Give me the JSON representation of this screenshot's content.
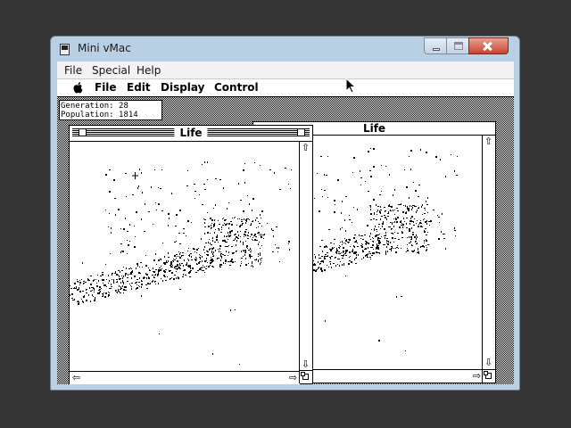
{
  "host": {
    "title": "Mini vMac",
    "menus": [
      "File",
      "Special",
      "Help"
    ]
  },
  "mac": {
    "menus": [
      "File",
      "Edit",
      "Display",
      "Control"
    ],
    "stats": {
      "generation_label": "Generation:",
      "generation": "28",
      "population_label": "Population:",
      "population": "1814"
    },
    "windows": [
      {
        "title": "Life",
        "active": true
      },
      {
        "title": "Life",
        "active": false
      }
    ]
  },
  "colors": {
    "host_frame": "#b9cfe3",
    "close_button": "#c7432e",
    "background": "#353535"
  },
  "icons": [
    "apple-icon",
    "close-box-icon",
    "zoom-box-icon",
    "scroll-up-arrow-icon",
    "scroll-down-arrow-icon",
    "scroll-left-arrow-icon",
    "scroll-right-arrow-icon",
    "grow-box-icon"
  ]
}
